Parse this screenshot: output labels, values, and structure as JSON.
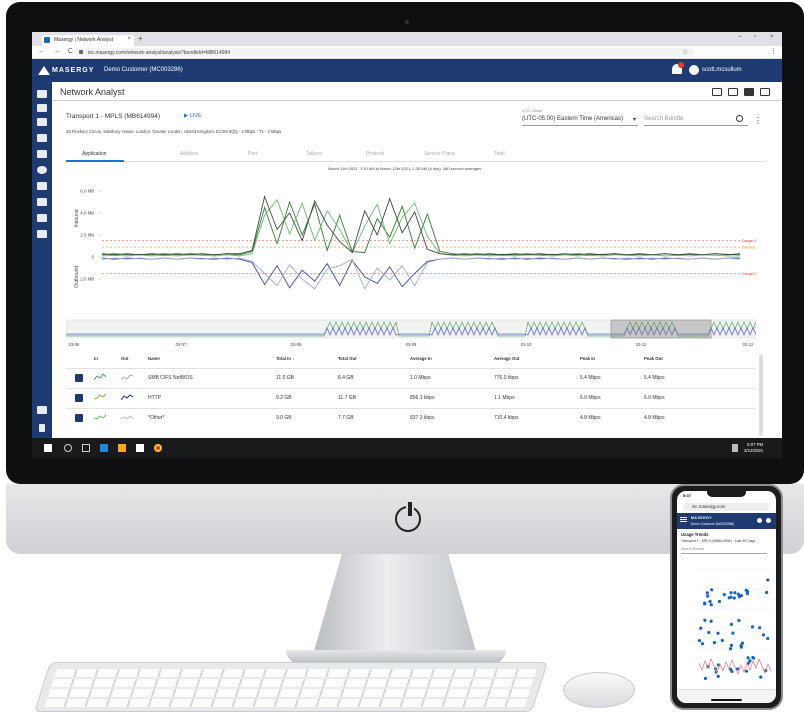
{
  "browser": {
    "tab_title": "Masergy | Network Analyst",
    "tab_close": "×",
    "new_tab": "+",
    "url": "isc.masergy.com/network-analyst/analysis?bundleId=MB614994",
    "nav": "← → C",
    "star": "☆",
    "menu": "⋮",
    "win_min": "–",
    "win_max": "▫",
    "win_close": "×"
  },
  "app": {
    "logo_text": "MASERGY",
    "customer": "Demo Customer (MC003286)",
    "username": "scott.mcsullum",
    "page_title": "Network Analyst",
    "accent": "#1e3a70"
  },
  "bundle": {
    "title": "Transport 1 - MPLS (MB614994)",
    "live": "▶ LIVE",
    "address": "29 Finsbury Circus, Salisbury House, London, Greater London, United Kingdom, EC2M 5QQ - 3 Mbps - T1 - 3 Mbps",
    "tz_label": "UTC Offset",
    "tz_value": "(UTC-05:00) Eastern Time (Americas)",
    "tz_caret": "▾",
    "search_placeholder": "Search Bundle",
    "kebab": "⋮"
  },
  "tabs": [
    "Application",
    "Address",
    "Port",
    "Talkers",
    "Protocol",
    "Service Plane",
    "Total"
  ],
  "chart_data": {
    "type": "line",
    "title": "March 11th 2021, 1:30 AM to March 12th 2021, 1:30 AM (a day), 480 second averages",
    "y_inbound_label": "Inbound",
    "y_outbound_label": "Outbound",
    "y_ticks": [
      "6.0 Mb",
      "4.0 Mb",
      "2.0 Mb",
      "0",
      "2.0 Mb"
    ],
    "x_ticks": [
      "1:40",
      "6:20",
      "11:00",
      "3:40",
      "8:20",
      "1:00"
    ],
    "ylim": [
      -3.0,
      7.0
    ],
    "thresholds": [
      {
        "label": "Danger 1.5 Mb",
        "value": 1.5,
        "color": "#e53935"
      },
      {
        "label": "Warning 900 Kb",
        "value": 0.9,
        "color": "#fb8c00"
      },
      {
        "label": "Danger 1.5 Mb",
        "value": -1.5,
        "color": "#e53935"
      }
    ],
    "series": [
      {
        "color": "#2e7d32",
        "values": [
          0.2,
          0.3,
          0.2,
          0.25,
          0.2,
          0.3,
          0.2,
          0.3,
          0.25,
          0.2,
          0.3,
          0.2,
          0.5,
          4.5,
          1.2,
          5.0,
          2.0,
          4.8,
          0.6,
          3.8,
          0.5,
          0.4,
          3.5,
          1.8,
          4.6,
          0.8,
          3.9,
          0.5,
          0.3,
          0.2,
          0.3,
          0.2,
          0.25,
          0.2,
          0.3,
          0.2,
          0.25,
          0.2,
          0.3,
          0.2,
          0.25,
          0.3,
          0.2,
          0.25,
          0.2,
          0.3,
          0.2,
          0.25,
          0.2,
          0.3,
          0.25,
          0.2
        ]
      },
      {
        "color": "#66bb6a",
        "values": [
          0.1,
          0.15,
          0.1,
          0.2,
          0.1,
          0.15,
          0.1,
          0.2,
          0.15,
          0.1,
          0.2,
          0.1,
          0.3,
          3.8,
          5.2,
          2.1,
          4.9,
          1.5,
          4.2,
          2.5,
          0.4,
          2.8,
          4.8,
          1.2,
          3.6,
          4.9,
          1.9,
          0.3,
          0.15,
          0.1,
          0.2,
          0.1,
          0.15,
          0.1,
          0.2,
          0.15,
          0.1,
          0.2,
          0.1,
          0.15,
          0.1,
          0.2,
          0.15,
          0.1,
          0.2,
          0.1,
          0.15,
          0.1,
          0.2,
          0.15,
          0.1,
          0.1
        ]
      },
      {
        "color": "#424242",
        "values": [
          0.3,
          0.2,
          0.3,
          0.2,
          0.3,
          0.2,
          0.3,
          0.2,
          0.3,
          0.2,
          0.3,
          0.3,
          0.6,
          5.5,
          2.5,
          4.0,
          1.5,
          5.1,
          2.9,
          1.4,
          0.4,
          4.2,
          2.0,
          5.3,
          2.2,
          4.1,
          0.7,
          0.3,
          0.2,
          0.3,
          0.2,
          0.3,
          0.2,
          0.3,
          0.2,
          0.3,
          0.2,
          0.3,
          0.2,
          0.3,
          0.2,
          0.3,
          0.2,
          0.3,
          0.2,
          0.3,
          0.2,
          0.3,
          0.2,
          0.3,
          0.2,
          0.3
        ]
      },
      {
        "color": "#3949ab",
        "values": [
          -0.1,
          -0.2,
          -0.1,
          -0.15,
          -0.2,
          -0.1,
          -0.2,
          -0.1,
          -0.15,
          -0.2,
          -0.1,
          -0.2,
          -0.5,
          -2.5,
          -0.8,
          -2.8,
          -1.2,
          -2.2,
          -0.6,
          -2.6,
          -0.3,
          -1.8,
          -2.4,
          -0.9,
          -2.7,
          -1.5,
          -0.4,
          -0.2,
          -0.1,
          -0.2,
          -0.1,
          -0.15,
          -0.2,
          -0.1,
          -0.2,
          -0.1,
          -0.15,
          -0.2,
          -0.1,
          -0.2,
          -0.1,
          -0.15,
          -0.2,
          -0.1,
          -0.2,
          -0.1,
          -0.15,
          -0.2,
          -0.1,
          -0.2,
          -0.1,
          -0.1
        ]
      },
      {
        "color": "#9fa8da",
        "values": [
          -0.2,
          -0.1,
          -0.2,
          -0.1,
          -0.2,
          -0.1,
          -0.2,
          -0.1,
          -0.2,
          -0.1,
          -0.2,
          -0.1,
          -0.4,
          -1.5,
          -2.6,
          -0.7,
          -2.0,
          -2.9,
          -1.1,
          -0.8,
          -0.2,
          -2.9,
          -1.0,
          -2.1,
          -0.8,
          -2.6,
          -0.5,
          -0.2,
          -0.1,
          -0.2,
          -0.1,
          -0.2,
          -0.1,
          -0.2,
          -0.1,
          -0.2,
          -0.1,
          -0.2,
          -0.1,
          -0.2,
          -0.1,
          -0.2,
          -0.1,
          -0.2,
          -0.1,
          -0.2,
          -0.1,
          -0.2,
          -0.1,
          -0.2,
          -0.1,
          -0.2
        ]
      }
    ]
  },
  "navigator": {
    "x_ticks": [
      "03-06",
      "03-07",
      "03-08",
      "03-09",
      "03-10",
      "03-11",
      "03-12"
    ]
  },
  "table": {
    "headers": [
      "In",
      "Out",
      "Name",
      "Total In ↓",
      "Total Out",
      "Average In",
      "Average Out",
      "Peak In",
      "Peak Out"
    ],
    "rows": [
      {
        "name": "SMB CIFS NetBIOS",
        "total_in": "11.0 GB",
        "total_out": "8.4 GB",
        "avg_in": "1.0 Mbps",
        "avg_out": "776.0 kbps",
        "peak_in": "5.4 Mbps",
        "peak_out": "5.4 Mbps"
      },
      {
        "name": "HTTP",
        "total_in": "9.2 GB",
        "total_out": "11.7 GB",
        "avg_in": "856.1 kbps",
        "avg_out": "1.1 Mbps",
        "peak_in": "6.0 Mbps",
        "peak_out": "6.0 Mbps"
      },
      {
        "name": "*Other*",
        "total_in": "9.0 GB",
        "total_out": "7.7 GB",
        "avg_in": "837.3 kbps",
        "avg_out": "710.4 kbps",
        "peak_in": "4.8 Mbps",
        "peak_out": "4.8 Mbps"
      }
    ]
  },
  "taskbar": {
    "time": "5:07 PM",
    "date": "3/12/2021"
  },
  "phone": {
    "time": "5:07",
    "url": "isc.masergy.com",
    "logo": "MASERGY",
    "customer": "Demo Customer (MC003286)",
    "usage_title": "Usage Trends",
    "transport": "Transport 1 - MPLS (MB614994) · Last 90 Days",
    "search": "Search Bundle"
  }
}
